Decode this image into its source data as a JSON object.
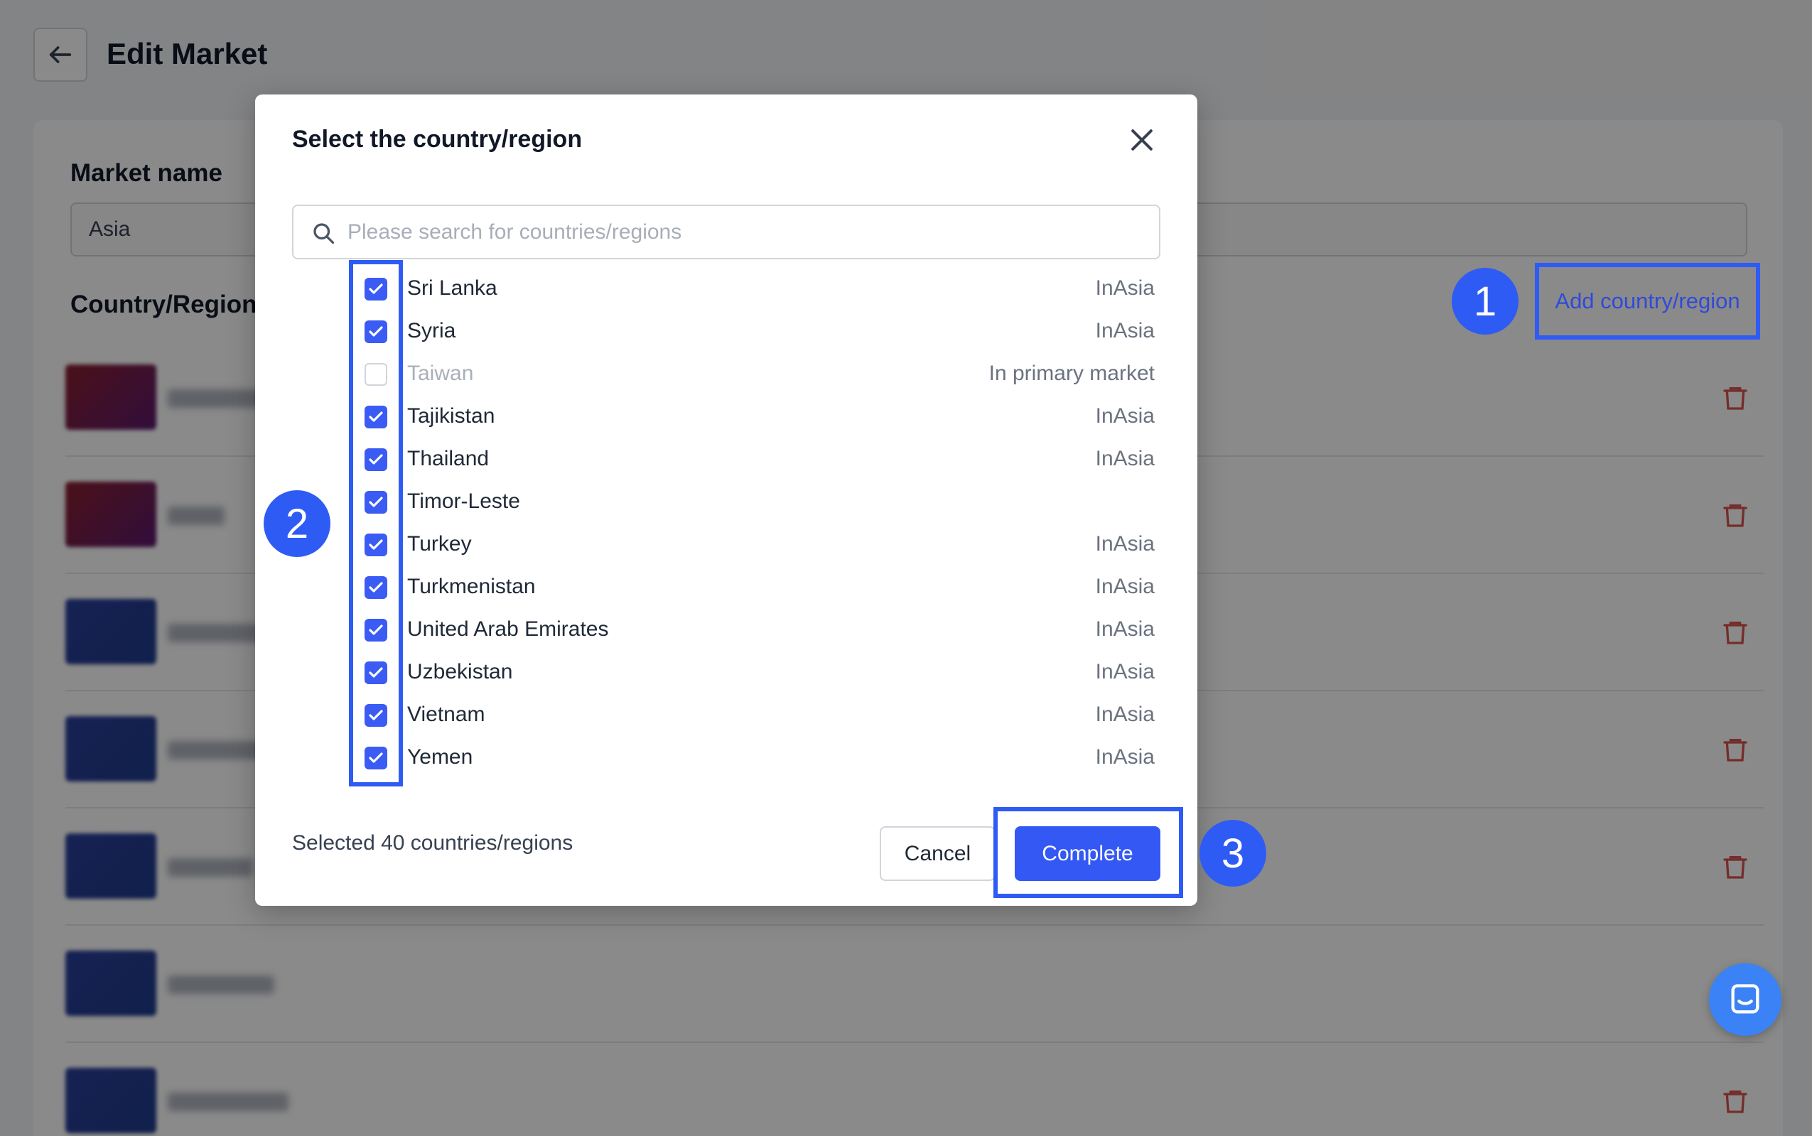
{
  "page": {
    "title": "Edit Market",
    "market_name_label": "Market name",
    "market_name_value": "Asia",
    "country_region_label": "Country/Region",
    "add_country_label": "Add country/region"
  },
  "modal": {
    "title": "Select the country/region",
    "search_placeholder": "Please search for countries/regions",
    "items": [
      {
        "name": "Sri Lanka",
        "tag": "InAsia",
        "checked": true,
        "disabled": false
      },
      {
        "name": "Syria",
        "tag": "InAsia",
        "checked": true,
        "disabled": false
      },
      {
        "name": "Taiwan",
        "tag": "In primary market",
        "checked": false,
        "disabled": true
      },
      {
        "name": "Tajikistan",
        "tag": "InAsia",
        "checked": true,
        "disabled": false
      },
      {
        "name": "Thailand",
        "tag": "InAsia",
        "checked": true,
        "disabled": false
      },
      {
        "name": "Timor-Leste",
        "tag": "",
        "checked": true,
        "disabled": false
      },
      {
        "name": "Turkey",
        "tag": "InAsia",
        "checked": true,
        "disabled": false
      },
      {
        "name": "Turkmenistan",
        "tag": "InAsia",
        "checked": true,
        "disabled": false
      },
      {
        "name": "United Arab Emirates",
        "tag": "InAsia",
        "checked": true,
        "disabled": false
      },
      {
        "name": "Uzbekistan",
        "tag": "InAsia",
        "checked": true,
        "disabled": false
      },
      {
        "name": "Vietnam",
        "tag": "InAsia",
        "checked": true,
        "disabled": false
      },
      {
        "name": "Yemen",
        "tag": "InAsia",
        "checked": true,
        "disabled": false
      }
    ],
    "selected_count": "Selected 40 countries/regions",
    "cancel_label": "Cancel",
    "complete_label": "Complete"
  },
  "annotations": {
    "badge_1": "1",
    "badge_2": "2",
    "badge_3": "3"
  },
  "colors": {
    "accent": "#3358f4",
    "annotation": "#2f5bf5",
    "delete": "#d9534f"
  }
}
